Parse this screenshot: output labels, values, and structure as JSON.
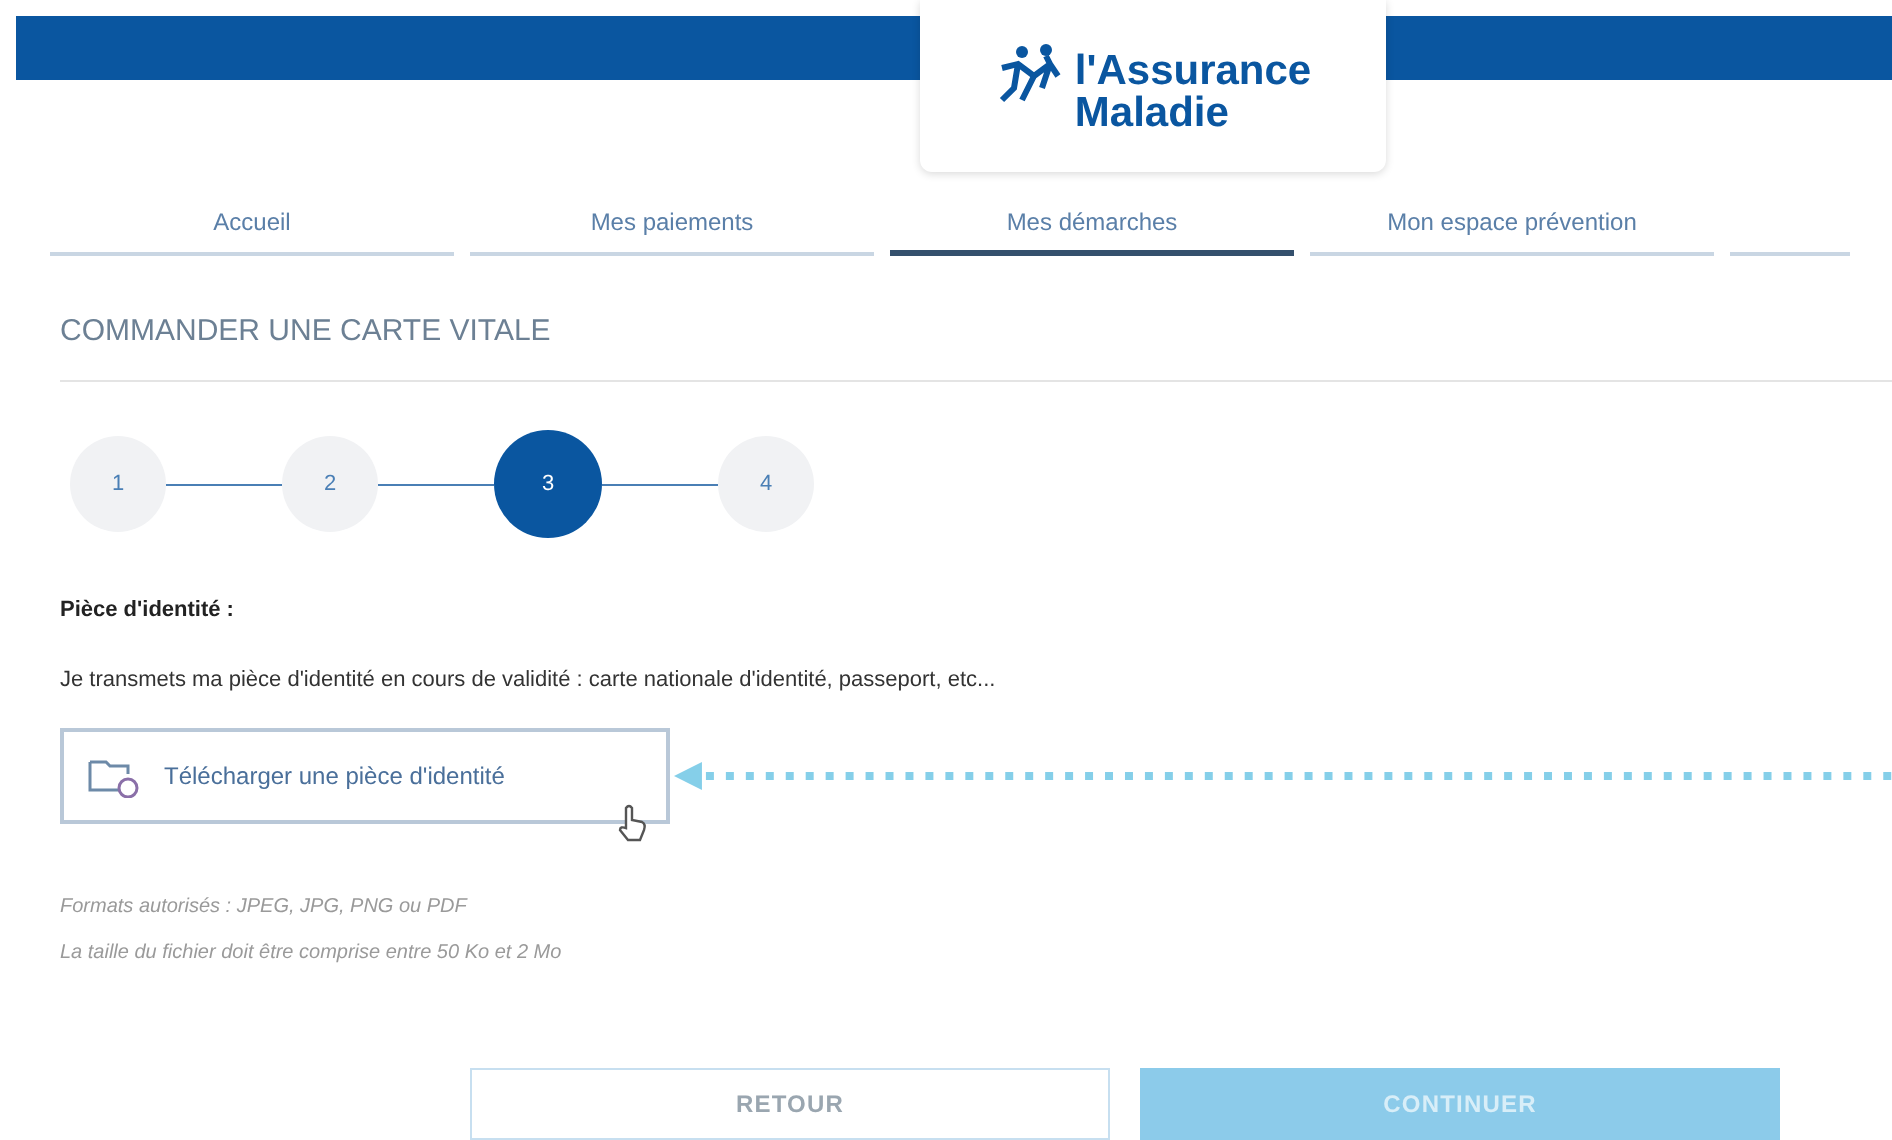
{
  "logo": {
    "line1": "l'Assurance",
    "line2": "Maladie"
  },
  "tabs": [
    {
      "label": "Accueil",
      "selected": false
    },
    {
      "label": "Mes paiements",
      "selected": false
    },
    {
      "label": "Mes démarches",
      "selected": true
    },
    {
      "label": "Mon espace prévention",
      "selected": false
    }
  ],
  "page_title": "COMMANDER UNE CARTE VITALE",
  "steps": [
    {
      "label": "1",
      "selected": false
    },
    {
      "label": "2",
      "selected": false
    },
    {
      "label": "3",
      "selected": true
    },
    {
      "label": "4",
      "selected": false
    }
  ],
  "section_label": "Pièce d'identité :",
  "description": "Je transmets ma pièce d'identité en cours de validité : carte nationale d'identité, passeport, etc...",
  "upload_button": "Télécharger une pièce d'identité",
  "hints": [
    "Formats autorisés : JPEG, JPG, PNG ou PDF",
    "La taille du fichier doit être comprise entre 50 Ko et 2 Mo"
  ],
  "buttons": [
    {
      "label": "RETOUR",
      "kind": "secondary",
      "disabled": false
    },
    {
      "label": "CONTINUER",
      "kind": "primary",
      "disabled": true
    }
  ]
}
